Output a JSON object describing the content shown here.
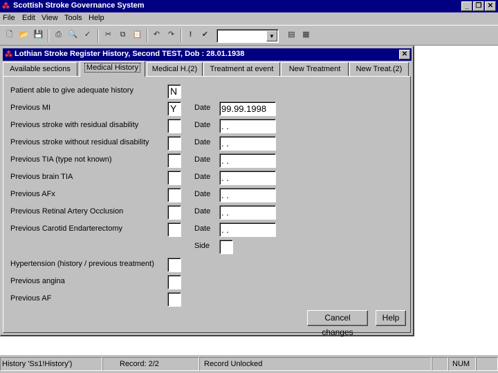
{
  "app": {
    "title": "Scottish Stroke Governance System",
    "icon": "app-logo-icon"
  },
  "menu": [
    {
      "label": "File"
    },
    {
      "label": "Edit"
    },
    {
      "label": "View"
    },
    {
      "label": "Tools"
    },
    {
      "label": "Help"
    }
  ],
  "toolbar": {
    "icons": [
      "new-icon",
      "open-icon",
      "save-icon",
      "print-icon",
      "print-preview-icon",
      "spellcheck-icon",
      "cut-icon",
      "copy-icon",
      "paste-icon",
      "undo-icon",
      "redo-icon",
      "exclamation-icon",
      "check-icon",
      "view-icon-1",
      "view-icon-2"
    ],
    "combo_value": ""
  },
  "child_window": {
    "title": "Lothian Stroke Register   History,  Second TEST, Dob : 28.01.1938",
    "close_glyph": "✕"
  },
  "tabs": [
    {
      "label": "Available sections",
      "active": false
    },
    {
      "label": "Medical History",
      "active": true
    },
    {
      "label": "Medical H.(2)",
      "active": false
    },
    {
      "label": "Treatment at event",
      "active": false
    },
    {
      "label": "New Treatment",
      "active": false
    },
    {
      "label": "New Treat.(2)",
      "active": false
    }
  ],
  "form": {
    "rows": [
      {
        "label": "Patient able to give adequate history",
        "value": "N"
      },
      {
        "label": "Previous MI",
        "value": "Y",
        "date_label": "Date",
        "date": "99.99.1998"
      },
      {
        "label": "Previous stroke with residual disability",
        "value": "",
        "date_label": "Date",
        "date": " .  ."
      },
      {
        "label": "Previous stroke without residual disability",
        "value": "",
        "date_label": "Date",
        "date": " .  ."
      },
      {
        "label": "Previous TIA (type not known)",
        "value": "",
        "date_label": "Date",
        "date": " .  ."
      },
      {
        "label": "Previous brain TIA",
        "value": "",
        "date_label": "Date",
        "date": " .  ."
      },
      {
        "label": "Previous AFx",
        "value": "",
        "date_label": "Date",
        "date": " .  ."
      },
      {
        "label": "Previous Retinal Artery Occlusion",
        "value": "",
        "date_label": "Date",
        "date": " .  ."
      },
      {
        "label": "Previous Carotid Endarterectomy",
        "value": "",
        "date_label": "Date",
        "date": " .  ."
      }
    ],
    "side_label": "Side",
    "side_value": "",
    "lower_rows": [
      {
        "label": "Hypertension (history / previous treatment)",
        "value": ""
      },
      {
        "label": "Previous angina",
        "value": ""
      },
      {
        "label": "Previous AF",
        "value": ""
      }
    ],
    "cancel_label": "Cancel changes",
    "help_label": "Help"
  },
  "status": {
    "history": "History 'Ss1!History')",
    "record": "Record: 2/2",
    "lock": "Record Unlocked",
    "num": "NUM"
  }
}
